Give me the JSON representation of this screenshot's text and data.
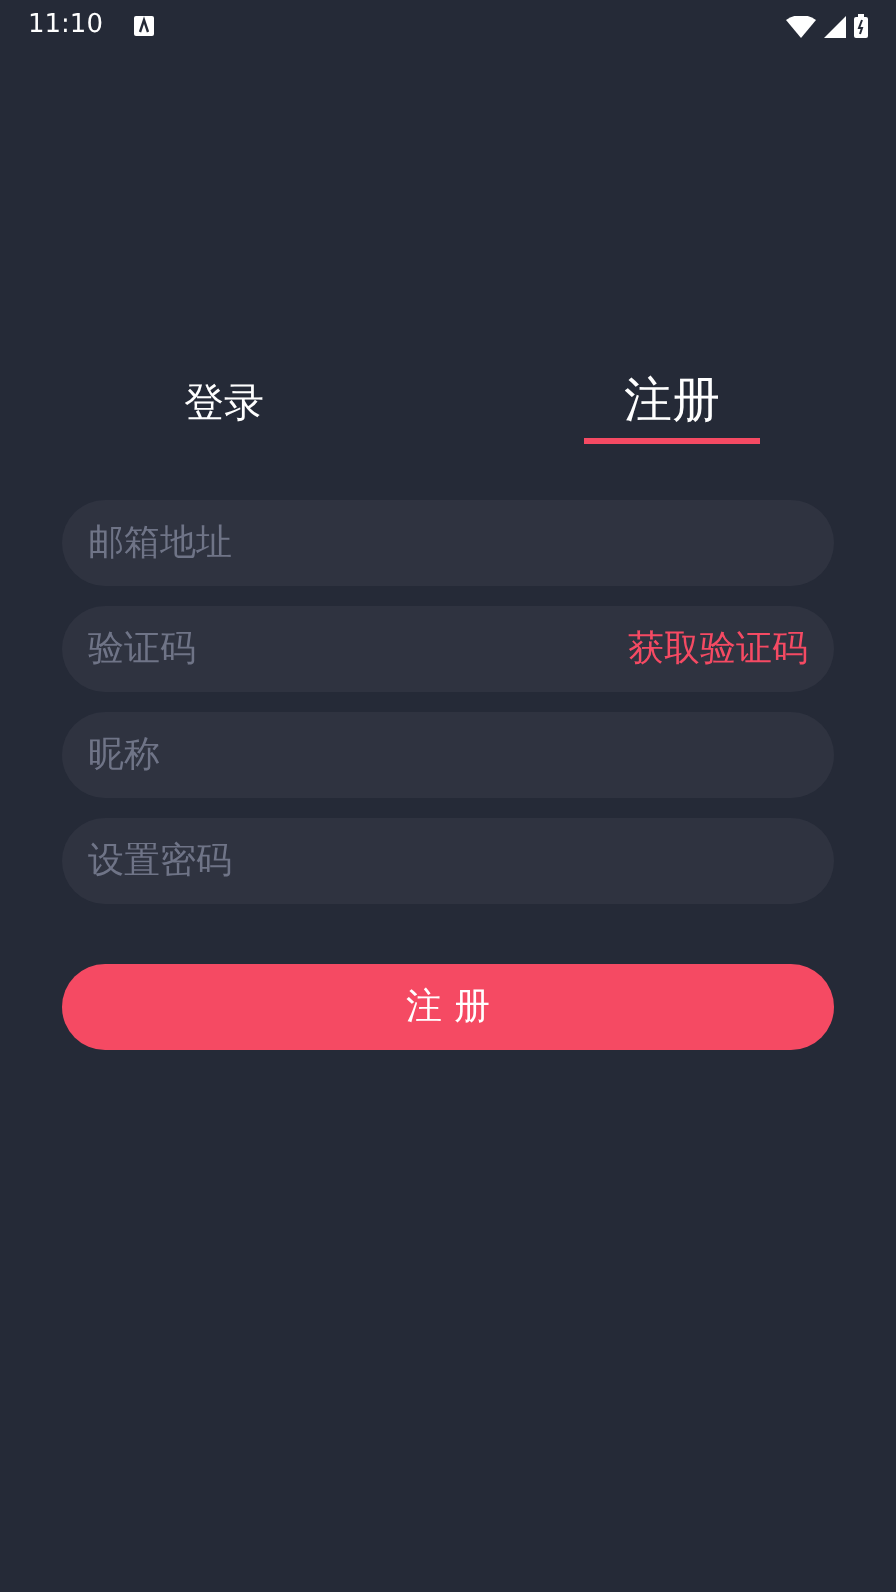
{
  "status_bar": {
    "time": "11:10"
  },
  "tabs": [
    {
      "label": "登录",
      "selected": false
    },
    {
      "label": "注册",
      "selected": true
    }
  ],
  "fields": [
    {
      "placeholder": "邮箱地址"
    },
    {
      "placeholder": "验证码",
      "action": "获取验证码"
    },
    {
      "placeholder": "昵称"
    },
    {
      "placeholder": "设置密码"
    }
  ],
  "submit_button": "注 册"
}
